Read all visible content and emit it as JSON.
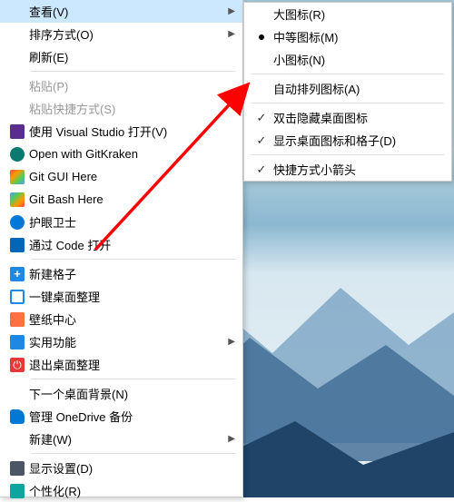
{
  "mainMenu": {
    "view": "查看(V)",
    "sort": "排序方式(O)",
    "refresh": "刷新(E)",
    "paste": "粘贴(P)",
    "pasteShortcut": "粘贴快捷方式(S)",
    "openVS": "使用 Visual Studio 打开(V)",
    "openGK": "Open with GitKraken",
    "gitGUI": "Git GUI Here",
    "gitBash": "Git Bash Here",
    "eyeCare": "护眼卫士",
    "openCode": "通过 Code 打开",
    "newGrid": "新建格子",
    "desktopTidy": "一键桌面整理",
    "wallpaper": "壁纸中心",
    "utility": "实用功能",
    "exitTidy": "退出桌面整理",
    "nextBg": "下一个桌面背景(N)",
    "onedrive": "管理 OneDrive 备份",
    "new": "新建(W)",
    "display": "显示设置(D)",
    "personalize": "个性化(R)"
  },
  "subMenu": {
    "large": "大图标(R)",
    "medium": "中等图标(M)",
    "small": "小图标(N)",
    "autoArrange": "自动排列图标(A)",
    "hideDbl": "双击隐藏桌面图标",
    "showGrid": "显示桌面图标和格子(D)",
    "shortcutArrow": "快捷方式小箭头"
  },
  "glyphs": {
    "chevron": "▶",
    "check": "✓",
    "plus": "+",
    "exit": "⏻"
  }
}
